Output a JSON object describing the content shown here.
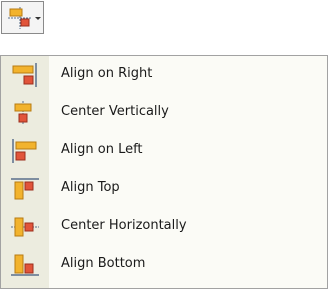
{
  "toolbar": {
    "button_icon": "align-distribute-icon",
    "arrow_icon": "chevron-down-icon"
  },
  "menu": {
    "items": [
      {
        "label": "Align on Right",
        "icon": "align-right-icon"
      },
      {
        "label": "Center Vertically",
        "icon": "center-vertical-icon"
      },
      {
        "label": "Align on Left",
        "icon": "align-left-icon"
      },
      {
        "label": "Align Top",
        "icon": "align-top-icon"
      },
      {
        "label": "Center Horizontally",
        "icon": "center-horizontal-icon"
      },
      {
        "label": "Align Bottom",
        "icon": "align-bottom-icon"
      }
    ]
  },
  "colors": {
    "shape_orange": "#f2b32d",
    "shape_red": "#e1543a",
    "guide": "#5a6f8c"
  }
}
